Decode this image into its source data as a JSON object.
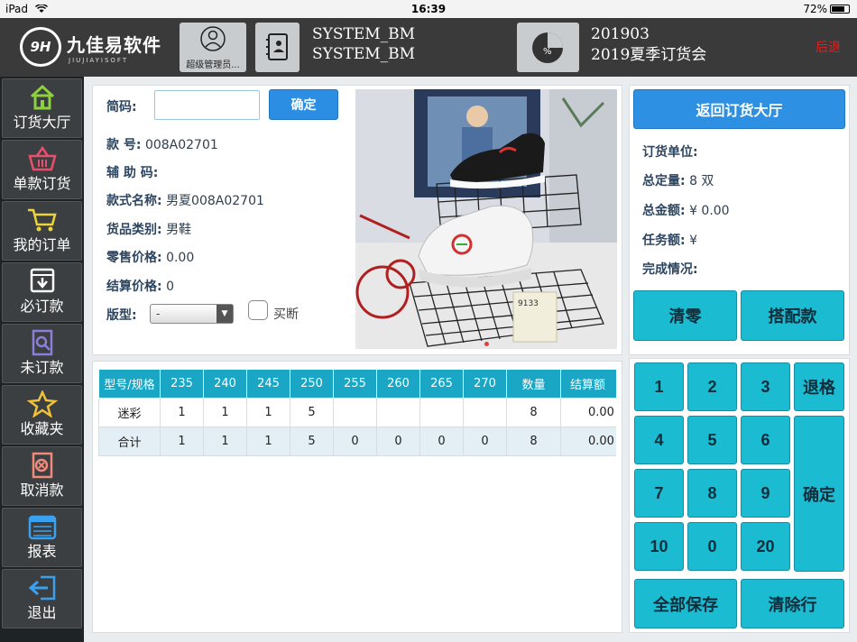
{
  "status_bar": {
    "device": "iPad",
    "time": "16:39",
    "battery": "72%"
  },
  "header": {
    "logo_circle": "9H",
    "logo_text": "九佳易软件",
    "logo_sub": "JIUJIAYISOFT",
    "user_label": "超级管理员...",
    "system_line1": "SYSTEM_BM",
    "system_line2": "SYSTEM_BM",
    "event_code": "201903",
    "event_name": "2019夏季订货会",
    "back_label": "后退",
    "chart_icon_text": "%"
  },
  "sidebar": {
    "items": [
      {
        "label": "订货大厅",
        "icon": "home-icon"
      },
      {
        "label": "单款订货",
        "icon": "basket-icon"
      },
      {
        "label": "我的订单",
        "icon": "cart-icon"
      },
      {
        "label": "必订款",
        "icon": "download-icon"
      },
      {
        "label": "未订款",
        "icon": "search-doc-icon"
      },
      {
        "label": "收藏夹",
        "icon": "star-icon"
      },
      {
        "label": "取消款",
        "icon": "cancel-doc-icon"
      },
      {
        "label": "报表",
        "icon": "calendar-icon"
      },
      {
        "label": "退出",
        "icon": "exit-icon"
      }
    ]
  },
  "product": {
    "code_label": "简码:",
    "code_value": "",
    "confirm_label": "确定",
    "style_no_label": "款 号:",
    "style_no": "008A02701",
    "aux_code_label": "辅 助 码:",
    "aux_code": "",
    "style_name_label": "款式名称:",
    "style_name": "男夏008A02701",
    "category_label": "货品类别:",
    "category": "男鞋",
    "retail_price_label": "零售价格:",
    "retail_price": "0.00",
    "settle_price_label": "结算价格:",
    "settle_price": "0",
    "version_label": "版型:",
    "version_value": "-",
    "buyout_label": "买断",
    "photo_tag": "9133"
  },
  "size_table": {
    "headers": [
      "型号/规格",
      "235",
      "240",
      "245",
      "250",
      "255",
      "260",
      "265",
      "270",
      "数量",
      "结算额"
    ],
    "rows": [
      [
        "迷彩",
        "1",
        "1",
        "1",
        "5",
        "",
        "",
        "",
        "",
        "8",
        "0.00"
      ],
      [
        "合计",
        "1",
        "1",
        "1",
        "5",
        "0",
        "0",
        "0",
        "0",
        "8",
        "0.00"
      ]
    ]
  },
  "summary": {
    "return_label": "返回订货大厅",
    "unit_label": "订货单位:",
    "unit_value": "",
    "total_qty_label": "总定量:",
    "total_qty_value": "8 双",
    "total_amount_label": "总金额:",
    "total_amount_value": "¥ 0.00",
    "task_amount_label": "任务额:",
    "task_amount_value": "¥",
    "completion_label": "完成情况:",
    "completion_value": "",
    "clear_label": "清零",
    "match_label": "搭配款"
  },
  "keypad": {
    "k1": "1",
    "k2": "2",
    "k3": "3",
    "back_size": "退格",
    "k4": "4",
    "k5": "5",
    "k6": "6",
    "confirm": "确定",
    "k7": "7",
    "k8": "8",
    "k9": "9",
    "k10": "10",
    "k0": "0",
    "k20": "20",
    "save_all": "全部保存",
    "clear_row": "清除行"
  },
  "colors": {
    "accent_blue": "#2e90e3",
    "keypad_cyan": "#1bbbd2",
    "table_header": "#1aa6c5",
    "back_red": "#e02020"
  }
}
